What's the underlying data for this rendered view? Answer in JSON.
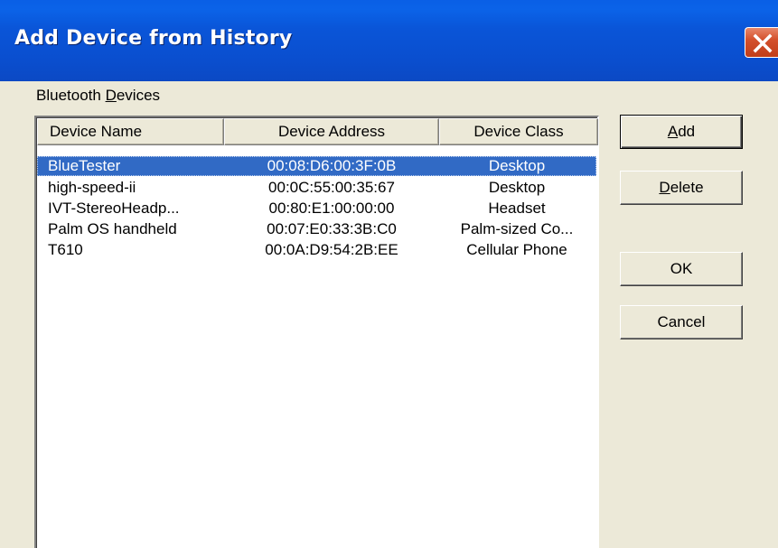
{
  "window": {
    "title": "Add Device from History"
  },
  "group": {
    "label_prefix": "Bluetooth ",
    "label_mnemonic": "D",
    "label_suffix": "evices"
  },
  "list": {
    "columns": [
      "Device Name",
      "Device Address",
      "Device Class"
    ],
    "rows": [
      {
        "name": "BlueTester",
        "address": "00:08:D6:00:3F:0B",
        "class": "Desktop",
        "selected": true
      },
      {
        "name": "high-speed-ii",
        "address": "00:0C:55:00:35:67",
        "class": "Desktop",
        "selected": false
      },
      {
        "name": "IVT-StereoHeadp...",
        "address": "00:80:E1:00:00:00",
        "class": "Headset",
        "selected": false
      },
      {
        "name": "Palm OS handheld",
        "address": "00:07:E0:33:3B:C0",
        "class": "Palm-sized Co...",
        "selected": false
      },
      {
        "name": "T610",
        "address": "00:0A:D9:54:2B:EE",
        "class": "Cellular Phone",
        "selected": false
      }
    ]
  },
  "buttons": {
    "add": {
      "mnemonic": "A",
      "rest": "dd"
    },
    "delete": {
      "mnemonic": "D",
      "rest": "elete"
    },
    "ok": {
      "label": "OK"
    },
    "cancel": {
      "label": "Cancel"
    }
  },
  "colors": {
    "title_bar": "#0a55d8",
    "selection": "#316ac5",
    "dialog_bg": "#ece9d8"
  },
  "icons": {
    "close": "close-icon"
  }
}
